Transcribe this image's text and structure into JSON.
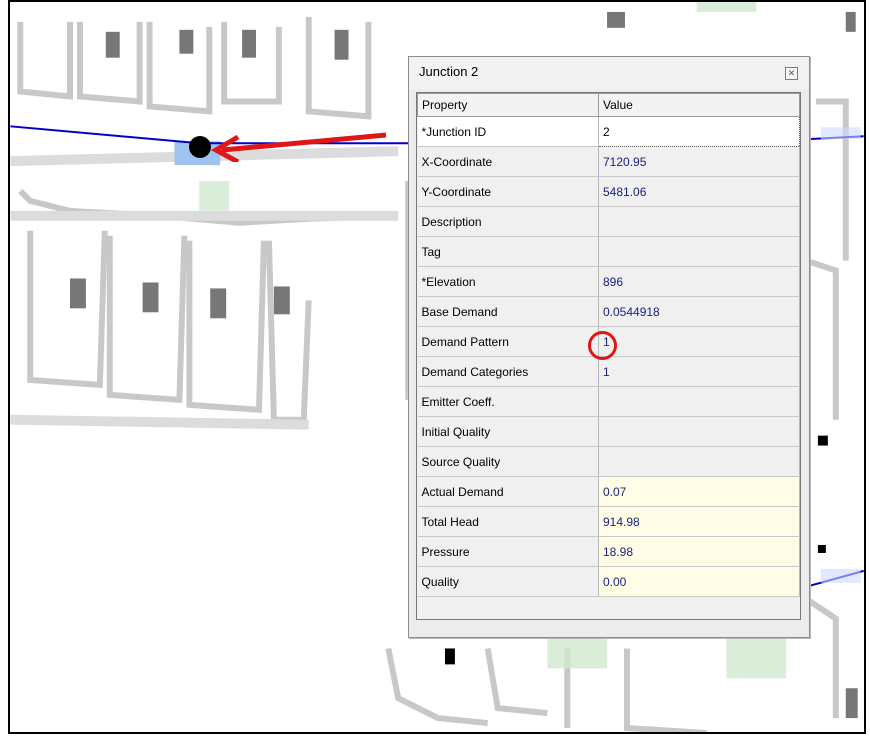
{
  "window": {
    "title": "Junction 2",
    "close_icon": "close-icon"
  },
  "grid": {
    "headers": {
      "property": "Property",
      "value": "Value"
    },
    "rows": [
      {
        "property": "*Junction ID",
        "value": "2"
      },
      {
        "property": "X-Coordinate",
        "value": "7120.95"
      },
      {
        "property": "Y-Coordinate",
        "value": "5481.06"
      },
      {
        "property": "Description",
        "value": ""
      },
      {
        "property": "Tag",
        "value": ""
      },
      {
        "property": "*Elevation",
        "value": "896"
      },
      {
        "property": "Base Demand",
        "value": "0.0544918"
      },
      {
        "property": "Demand Pattern",
        "value": "1"
      },
      {
        "property": "Demand Categories",
        "value": "1"
      },
      {
        "property": "Emitter Coeff.",
        "value": ""
      },
      {
        "property": "Initial Quality",
        "value": ""
      },
      {
        "property": "Source Quality",
        "value": ""
      },
      {
        "property": "Actual Demand",
        "value": "0.07"
      },
      {
        "property": "Total Head",
        "value": "914.98"
      },
      {
        "property": "Pressure",
        "value": "18.98"
      },
      {
        "property": "Quality",
        "value": "0.00"
      }
    ]
  },
  "annotations": {
    "highlight_color": "#e01616",
    "pipe_color": "#0000cc",
    "node_color": "#000000"
  }
}
